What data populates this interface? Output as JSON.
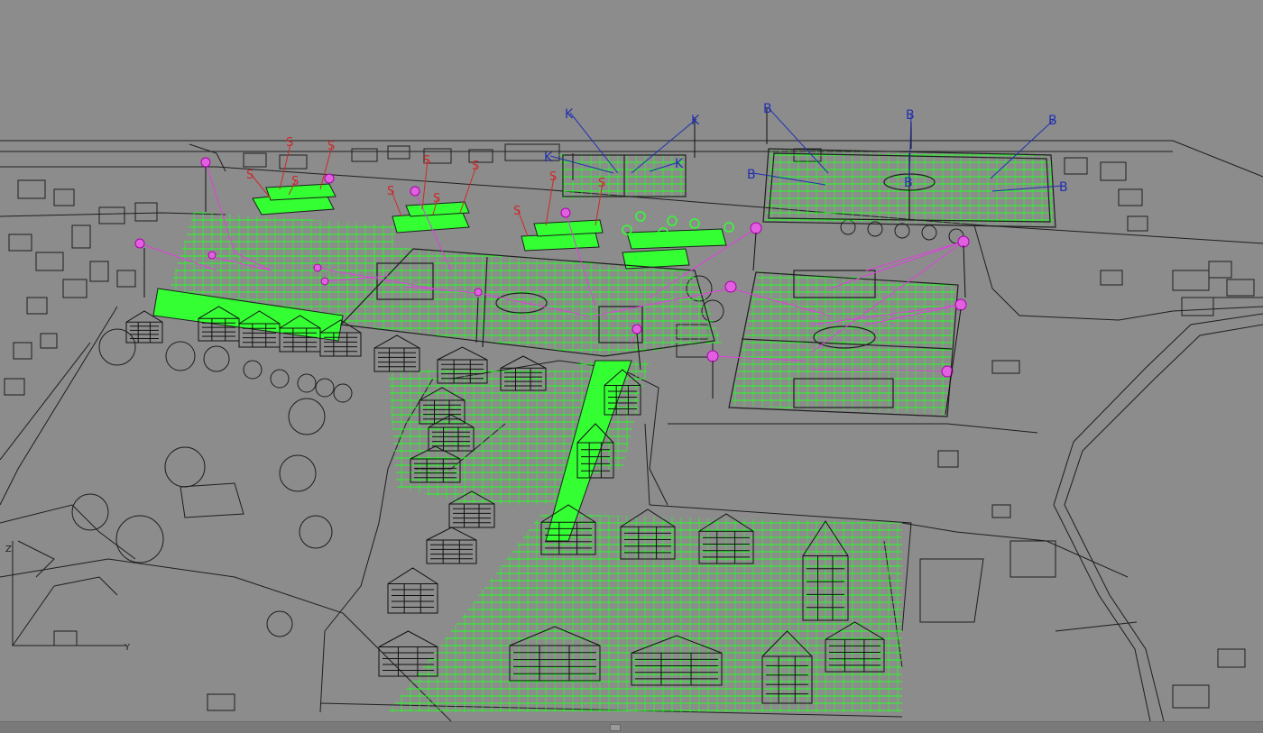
{
  "viewport": {
    "background": "#8c8c8c",
    "axis_labels": {
      "z": "Z",
      "y": "Y"
    }
  },
  "colors": {
    "linework": "#1e1e1e",
    "grid": "#22ff22",
    "lighting": "#e040e0",
    "speaker": "#cc2a2a",
    "camera_k": "#2030b0",
    "camera_b": "#2030b0"
  },
  "markers": {
    "k": [
      "K",
      "K",
      "K",
      "K"
    ],
    "b": [
      "B",
      "B",
      "B",
      "B",
      "B",
      "B"
    ],
    "s": [
      "S",
      "S",
      "S",
      "S",
      "S",
      "S",
      "S",
      "S",
      "S",
      "S",
      "S"
    ]
  },
  "icons": {
    "grid": "calculation-grid-icon",
    "luminaire": "luminaire-icon",
    "camera": "camera-icon"
  }
}
